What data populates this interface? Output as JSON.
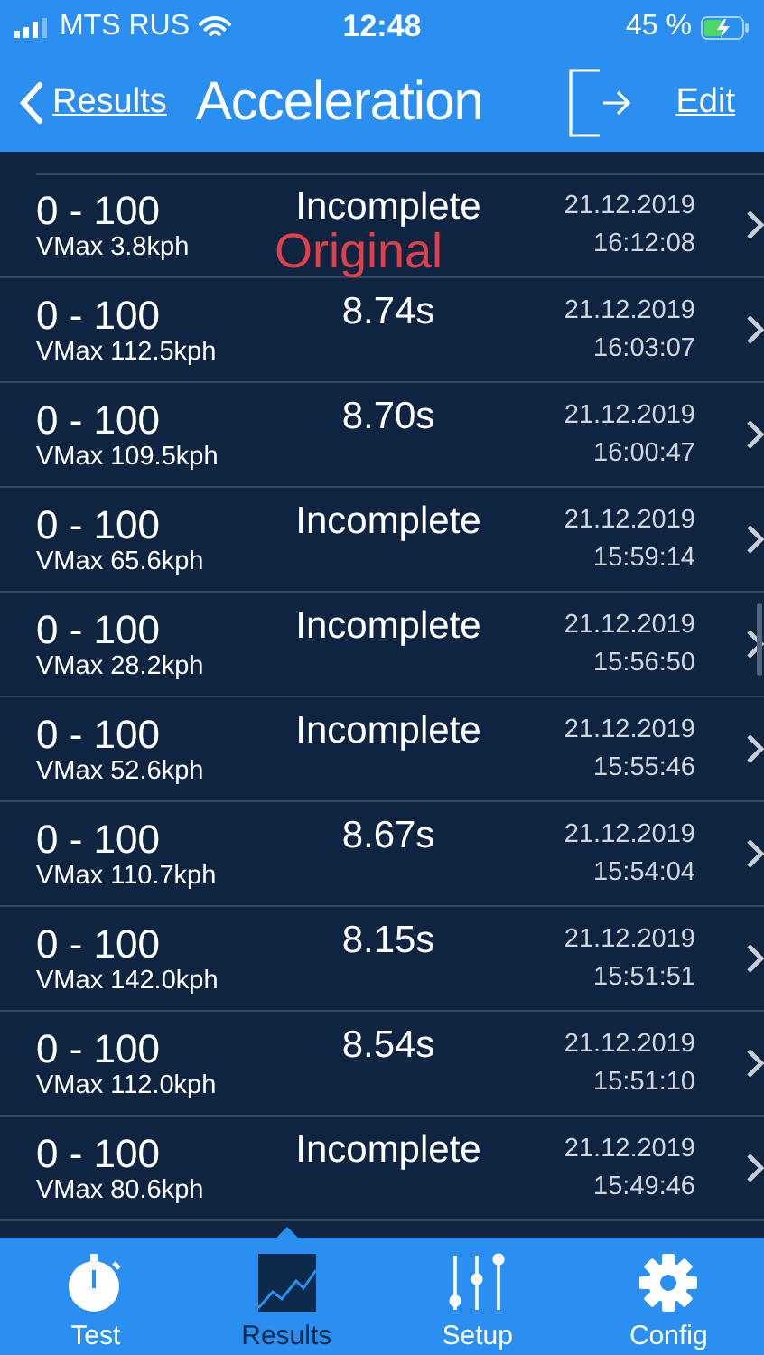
{
  "status_bar": {
    "carrier": "MTS RUS",
    "time": "12:48",
    "battery": "45 %"
  },
  "nav": {
    "back": "Results",
    "title": "Acceleration",
    "edit": "Edit"
  },
  "overlay_label": "Original",
  "rows": [
    {
      "range": "0 - 100",
      "vmax": "VMax 3.8kph",
      "result": "Incomplete",
      "date": "21.12.2019",
      "time": "16:12:08"
    },
    {
      "range": "0 - 100",
      "vmax": "VMax 112.5kph",
      "result": "8.74s",
      "date": "21.12.2019",
      "time": "16:03:07"
    },
    {
      "range": "0 - 100",
      "vmax": "VMax 109.5kph",
      "result": "8.70s",
      "date": "21.12.2019",
      "time": "16:00:47"
    },
    {
      "range": "0 - 100",
      "vmax": "VMax 65.6kph",
      "result": "Incomplete",
      "date": "21.12.2019",
      "time": "15:59:14"
    },
    {
      "range": "0 - 100",
      "vmax": "VMax 28.2kph",
      "result": "Incomplete",
      "date": "21.12.2019",
      "time": "15:56:50"
    },
    {
      "range": "0 - 100",
      "vmax": "VMax 52.6kph",
      "result": "Incomplete",
      "date": "21.12.2019",
      "time": "15:55:46"
    },
    {
      "range": "0 - 100",
      "vmax": "VMax 110.7kph",
      "result": "8.67s",
      "date": "21.12.2019",
      "time": "15:54:04"
    },
    {
      "range": "0 - 100",
      "vmax": "VMax 142.0kph",
      "result": "8.15s",
      "date": "21.12.2019",
      "time": "15:51:51"
    },
    {
      "range": "0 - 100",
      "vmax": "VMax 112.0kph",
      "result": "8.54s",
      "date": "21.12.2019",
      "time": "15:51:10"
    },
    {
      "range": "0 - 100",
      "vmax": "VMax 80.6kph",
      "result": "Incomplete",
      "date": "21.12.2019",
      "time": "15:49:46"
    }
  ],
  "tabs": [
    {
      "kind": "stopwatch",
      "label": "Test",
      "selected": false
    },
    {
      "kind": "chart",
      "label": "Results",
      "selected": true
    },
    {
      "kind": "sliders",
      "label": "Setup",
      "selected": false
    },
    {
      "kind": "gear",
      "label": "Config",
      "selected": false
    }
  ]
}
